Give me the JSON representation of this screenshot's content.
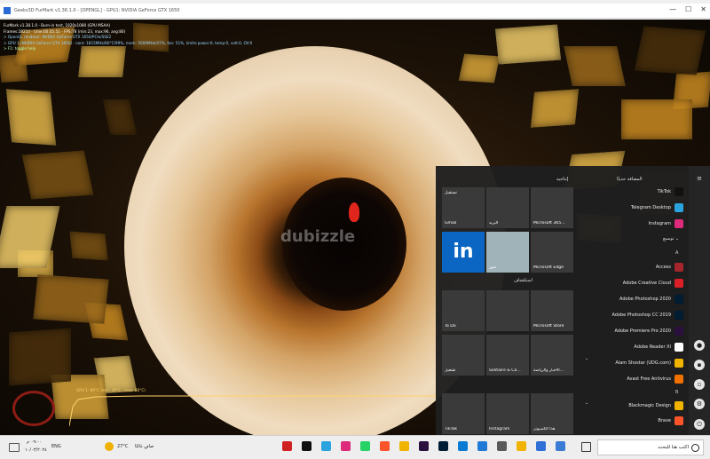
{
  "window": {
    "title": "Geeks3D FurMark v1.38.1.0 - [OPENGL] - GPU1: NVIDIA GeForce GTX 1650",
    "controls": [
      "—",
      "☐",
      "✕"
    ]
  },
  "osd": {
    "line1": "FurMark v1.38.1.0 - Burn-in test, 1920x1080 (GPU MSAA)",
    "line2": "Frames:28210 - time:00:05:51 - FPS:78 (min:23, max:96, avg:80)",
    "line3": "> OpenGL renderer: NVIDIA GeForce GTX 1650/PCIe/SSE2",
    "line4": "> GPU 1 (NVIDIA GeForce GTX 1650) - core: 1815MHz/80°C/99%, mem: 5000MHz/47%, fan: 51%, limits:power:0, temp:0, volt:0, OV:0",
    "line5": "> F1: toggle help"
  },
  "graph": {
    "label": "GPU 1: 80°C (min: 39°C - max: 80°C)",
    "temp_min": 39,
    "temp_max": 80,
    "temp_current": 80
  },
  "watermark": "dubizzle",
  "start_menu": {
    "pinned_header": "إنتاجية",
    "explore_header": "استكشاف",
    "recent_header": "المضافة حديثًا",
    "expand_label": "توسيع ⌄",
    "tiles": [
      {
        "label": "Gmail",
        "sublabel": "نستقبل",
        "color": "#3a3a3a"
      },
      {
        "label": "البريد",
        "color": "#3a3a3a"
      },
      {
        "label": "Microsoft 365...",
        "color": "#3a3a3a"
      },
      {
        "label": "in",
        "color": "#0a66c2"
      },
      {
        "label": "صور",
        "color": "#9fb3b8"
      },
      {
        "label": "Microsoft Edge",
        "color": "#3a3a3a"
      },
      {
        "label": "To Do",
        "color": "#3a3a3a"
      },
      {
        "label": "",
        "color": "#3a3a3a"
      },
      {
        "label": "Microsoft Store",
        "color": "#3a3a3a"
      },
      {
        "label": "تشغيل",
        "color": "#3a3a3a"
      },
      {
        "label": "Solitaire & Ca...",
        "color": "#3a3a3a"
      },
      {
        "label": "الأخبار والرياضة...",
        "color": "#3a3a3a"
      },
      {
        "label": "TikTok",
        "color": "#3a3a3a"
      },
      {
        "label": "Instagram",
        "color": "#3a3a3a"
      },
      {
        "label": "هذا الكمبيوتر",
        "color": "#3a3a3a"
      }
    ],
    "recent_apps": [
      {
        "label": "TikTok",
        "color": "#111111"
      },
      {
        "label": "Telegram Desktop",
        "color": "#2aa3df"
      },
      {
        "label": "Instagram",
        "color": "#dd2a7b"
      }
    ],
    "letter_a": "A",
    "apps": [
      {
        "label": "Access",
        "color": "#a4262c"
      },
      {
        "label": "Adobe Creative Cloud",
        "color": "#da1f26"
      },
      {
        "label": "Adobe Photoshop 2020",
        "color": "#001d34"
      },
      {
        "label": "Adobe Photoshop CC 2019",
        "color": "#001d34"
      },
      {
        "label": "Adobe Premiere Pro 2020",
        "color": "#2a0f3f"
      },
      {
        "label": "Adobe Reader XI",
        "color": "#ffffff"
      },
      {
        "label": "Alam Shostar (UDG.com)",
        "color": "#f0b400"
      },
      {
        "label": "Avast Free Antivirus",
        "color": "#f07000"
      }
    ],
    "letter_b": "B",
    "apps_b": [
      {
        "label": "Blackmagic Design",
        "color": "#f0b400"
      },
      {
        "label": "Brave",
        "color": "#fb542b"
      }
    ]
  },
  "taskbar": {
    "date": "١٠/٠٣/٢٠٢٤",
    "time": "٠٩:٠٠ م",
    "lang": "ENG",
    "weather_temp": "27°C",
    "weather_text": "صافٍ غالبًا",
    "search_placeholder": "اكتب هنا للبحث",
    "pinned": [
      {
        "name": "furmark",
        "color": "#d02020"
      },
      {
        "name": "tiktok",
        "color": "#111111"
      },
      {
        "name": "telegram",
        "color": "#2aa3df"
      },
      {
        "name": "instagram",
        "color": "#dd2a7b"
      },
      {
        "name": "whatsapp",
        "color": "#25d366"
      },
      {
        "name": "brave",
        "color": "#fb542b"
      },
      {
        "name": "files",
        "color": "#f0b400"
      },
      {
        "name": "premiere",
        "color": "#2a0f3f"
      },
      {
        "name": "photoshop",
        "color": "#001d34"
      },
      {
        "name": "edge",
        "color": "#0a7bd4"
      },
      {
        "name": "mail",
        "color": "#1f7ad6"
      },
      {
        "name": "store",
        "color": "#5a5a5a"
      },
      {
        "name": "explorer",
        "color": "#f0b400"
      },
      {
        "name": "todo",
        "color": "#2f6fd6"
      },
      {
        "name": "widgets",
        "color": "#3a7bd5"
      }
    ]
  }
}
